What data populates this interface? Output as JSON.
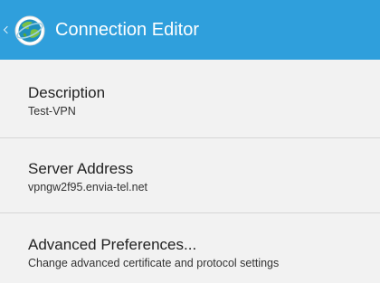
{
  "action_bar": {
    "title": "Connection Editor",
    "app_icon": "anyconnect-globe-icon",
    "up_icon": "chevron-left-icon",
    "background_color": "#2f9fdc"
  },
  "preferences": {
    "description": {
      "title": "Description",
      "summary": "Test-VPN"
    },
    "server_address": {
      "title": "Server Address",
      "summary": "vpngw2f95.envia-tel.net"
    },
    "advanced": {
      "title": "Advanced Preferences...",
      "summary": "Change advanced certificate and protocol settings"
    }
  }
}
